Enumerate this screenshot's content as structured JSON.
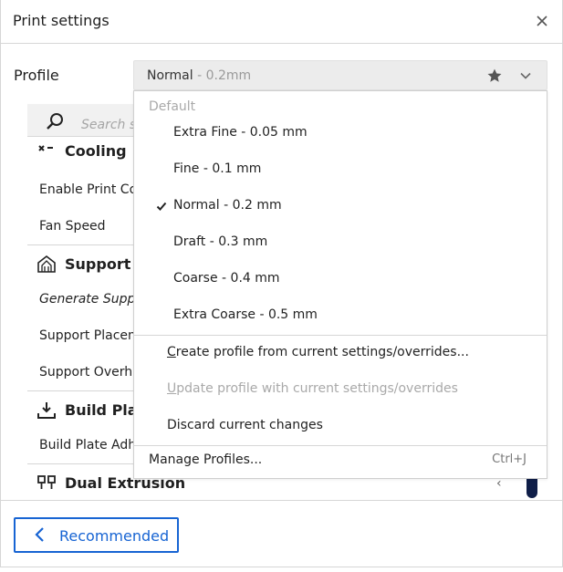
{
  "header": {
    "title": "Print settings"
  },
  "profile": {
    "label": "Profile",
    "selected": "Normal",
    "selected_sub": " - 0.2mm"
  },
  "search": {
    "placeholder": "Search se"
  },
  "settings": {
    "cooling_label": "Cooling",
    "enable_print_cooling": "Enable Print Coo",
    "fan_speed": "Fan Speed",
    "support_label": "Support",
    "generate_support": "Generate Suppor",
    "support_placement": "Support Placem",
    "support_overhang": "Support Overha",
    "build_plate_label": "Build Plat",
    "build_plate_adhesion": "Build Plate Adhe",
    "dual_extrusion_label": "Dual Extrusion"
  },
  "dropdown": {
    "section_label": "Default",
    "items": [
      {
        "label": "Extra Fine - 0.05 mm",
        "checked": false
      },
      {
        "label": "Fine - 0.1 mm",
        "checked": false
      },
      {
        "label": "Normal - 0.2 mm",
        "checked": true
      },
      {
        "label": "Draft - 0.3 mm",
        "checked": false
      },
      {
        "label": "Coarse - 0.4 mm",
        "checked": false
      },
      {
        "label": "Extra Coarse - 0.5 mm",
        "checked": false
      }
    ],
    "create_first": "C",
    "create_rest": "reate profile from current settings/overrides...",
    "update_first": "U",
    "update_rest": "pdate profile with current settings/overrides",
    "discard": "Discard current changes",
    "manage": "Manage Profiles...",
    "manage_shortcut": "Ctrl+J"
  },
  "footer": {
    "recommended_label": "Recommended"
  },
  "colors": {
    "accent": "#1764d3",
    "scroll_thumb": "#0f1e48"
  }
}
